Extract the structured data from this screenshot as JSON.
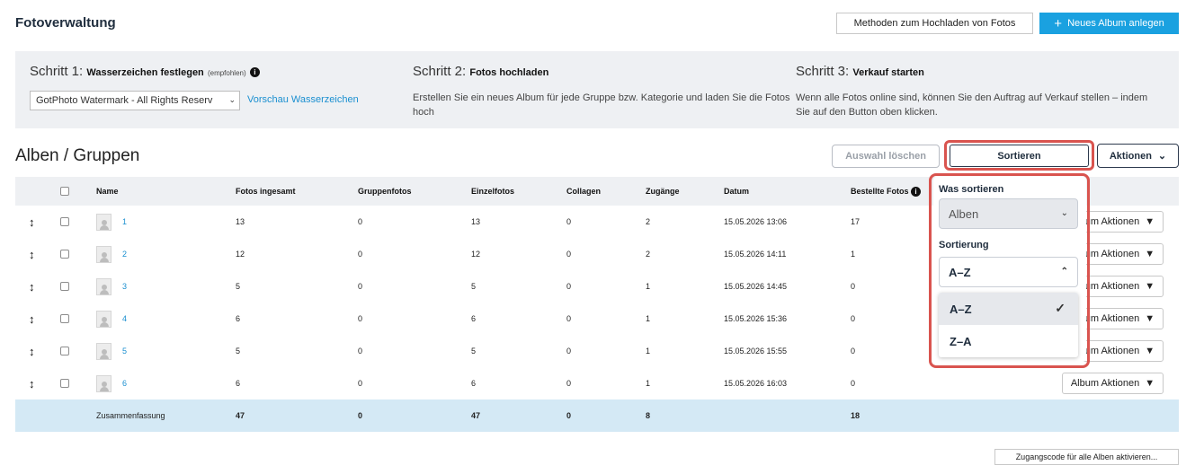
{
  "header": {
    "title": "Fotoverwaltung",
    "methods_button": "Methoden zum Hochladen von Fotos",
    "new_album_button": "Neues Album anlegen",
    "new_album_icon": "plus-icon"
  },
  "steps": {
    "step1": {
      "prefix": "Schritt 1:",
      "title": "Wasserzeichen festlegen",
      "note": "(empfohlen)",
      "info_icon": "info-icon",
      "select_value": "GotPhoto Watermark - All Rights Reserv",
      "preview_link": "Vorschau Wasserzeichen"
    },
    "step2": {
      "prefix": "Schritt 2:",
      "title": "Fotos hochladen",
      "body": "Erstellen Sie ein neues Album für jede Gruppe bzw. Kategorie und laden Sie die Fotos hoch"
    },
    "step3": {
      "prefix": "Schritt 3:",
      "title": "Verkauf starten",
      "body": "Wenn alle Fotos online sind, können Sie den Auftrag auf Verkauf stellen – indem Sie auf den Button oben klicken."
    }
  },
  "albums": {
    "title": "Alben / Gruppen",
    "clear_button": "Auswahl löschen",
    "sort_button": "Sortieren",
    "actions_button": "Aktionen",
    "columns": [
      "Name",
      "Fotos ingesamt",
      "Gruppenfotos",
      "Einzelfotos",
      "Collagen",
      "Zugänge",
      "Datum",
      "Bestellte Fotos"
    ],
    "rows": [
      {
        "name": "1",
        "total": "13",
        "group": "0",
        "single": "13",
        "collages": "0",
        "access": "2",
        "date": "15.05.2026 13:06",
        "ordered": "17",
        "action": "Album Aktionen"
      },
      {
        "name": "2",
        "total": "12",
        "group": "0",
        "single": "12",
        "collages": "0",
        "access": "2",
        "date": "15.05.2026 14:11",
        "ordered": "1",
        "action": "Album Aktionen"
      },
      {
        "name": "3",
        "total": "5",
        "group": "0",
        "single": "5",
        "collages": "0",
        "access": "1",
        "date": "15.05.2026 14:45",
        "ordered": "0",
        "action": "Album Aktionen"
      },
      {
        "name": "4",
        "total": "6",
        "group": "0",
        "single": "6",
        "collages": "0",
        "access": "1",
        "date": "15.05.2026 15:36",
        "ordered": "0",
        "action": "Album Aktionen"
      },
      {
        "name": "5",
        "total": "5",
        "group": "0",
        "single": "5",
        "collages": "0",
        "access": "1",
        "date": "15.05.2026 15:55",
        "ordered": "0",
        "action": "Album Aktionen"
      },
      {
        "name": "6",
        "total": "6",
        "group": "0",
        "single": "6",
        "collages": "0",
        "access": "1",
        "date": "15.05.2026 16:03",
        "ordered": "0",
        "action": "Album Aktionen"
      }
    ],
    "summary": {
      "label": "Zusammenfassung",
      "total": "47",
      "group": "0",
      "single": "47",
      "collages": "0",
      "access": "8",
      "ordered": "18"
    }
  },
  "sort_panel": {
    "what_label": "Was sortieren",
    "what_value": "Alben",
    "order_label": "Sortierung",
    "order_value": "A–Z",
    "options": [
      "A–Z",
      "Z–A"
    ],
    "selected_option": "A–Z",
    "highlight_color": "#d9544f"
  },
  "footer": {
    "codes_button": "Zugangscode für alle Alben aktivieren..."
  },
  "colors": {
    "accent": "#1aa1e0",
    "link": "#1a8fd0",
    "panel_bg": "#eef0f3",
    "summary_bg": "#d4e9f5"
  }
}
